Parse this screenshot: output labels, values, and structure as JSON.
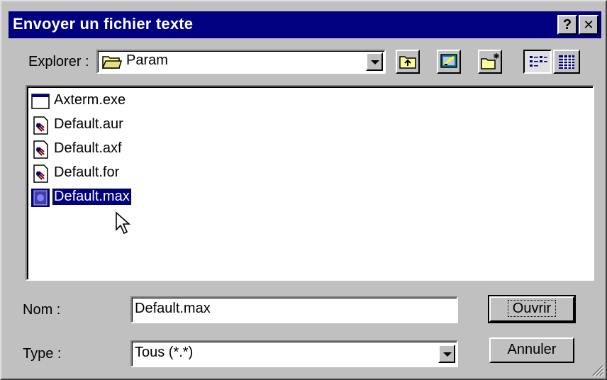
{
  "window": {
    "title": "Envoyer un fichier texte",
    "help_label": "?",
    "close_label": "✕"
  },
  "lookin": {
    "label": "Explorer :",
    "value": "Param"
  },
  "toolbar": [
    "up-folder",
    "desktop",
    "new-folder",
    "list-view",
    "details-view"
  ],
  "files": [
    {
      "name": "Axterm.exe",
      "icon": "application-icon"
    },
    {
      "name": "Default.aur",
      "icon": "document-icon"
    },
    {
      "name": "Default.axf",
      "icon": "document-icon"
    },
    {
      "name": "Default.for",
      "icon": "document-icon"
    },
    {
      "name": "Default.max",
      "icon": "max-file-icon",
      "selected": true
    }
  ],
  "filename": {
    "label": "Nom :",
    "value": "Default.max"
  },
  "filetype": {
    "label": "Type :",
    "value": "Tous (*.*)"
  },
  "buttons": {
    "open": "Ouvrir",
    "cancel": "Annuler"
  },
  "colors": {
    "titlebar": "#000080",
    "face": "#c0c0c0",
    "selection": "#000080"
  }
}
